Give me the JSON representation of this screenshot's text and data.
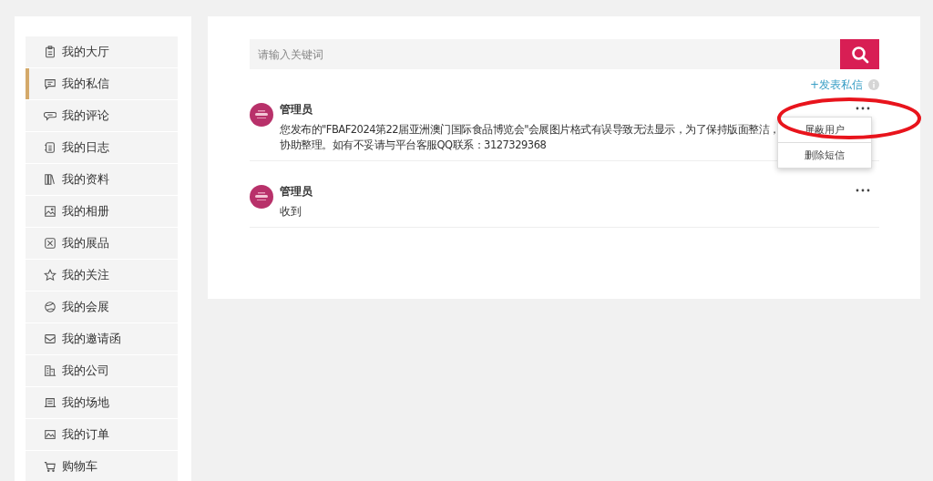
{
  "sidebar": {
    "items": [
      {
        "label": "我的大厅",
        "selected": false
      },
      {
        "label": "我的私信",
        "selected": true
      },
      {
        "label": "我的评论",
        "selected": false
      },
      {
        "label": "我的日志",
        "selected": false
      },
      {
        "label": "我的资料",
        "selected": false
      },
      {
        "label": "我的相册",
        "selected": false
      },
      {
        "label": "我的展品",
        "selected": false
      },
      {
        "label": "我的关注",
        "selected": false
      },
      {
        "label": "我的会展",
        "selected": false
      },
      {
        "label": "我的邀请函",
        "selected": false
      },
      {
        "label": "我的公司",
        "selected": false
      },
      {
        "label": "我的场地",
        "selected": false
      },
      {
        "label": "我的订单",
        "selected": false
      },
      {
        "label": "购物车",
        "selected": false
      }
    ]
  },
  "search": {
    "placeholder": "请输入关键词"
  },
  "compose_link": "+发表私信",
  "messages": [
    {
      "sender": "管理员",
      "lines": [
        "您发布的\"FBAF2024第22届亚洲澳门国际食品博览会\"会展图片格式有误导致无法显示，为了保持版面整洁，",
        "协助整理。如有不妥请与平台客服QQ联系：3127329368"
      ],
      "menu_open": true
    },
    {
      "sender": "管理员",
      "lines": [
        "收到"
      ],
      "menu_open": false
    }
  ],
  "message_menu": [
    "屏蔽用户",
    "删除短信"
  ],
  "annotation": {
    "kind": "ellipse",
    "color": "#e8141c"
  }
}
